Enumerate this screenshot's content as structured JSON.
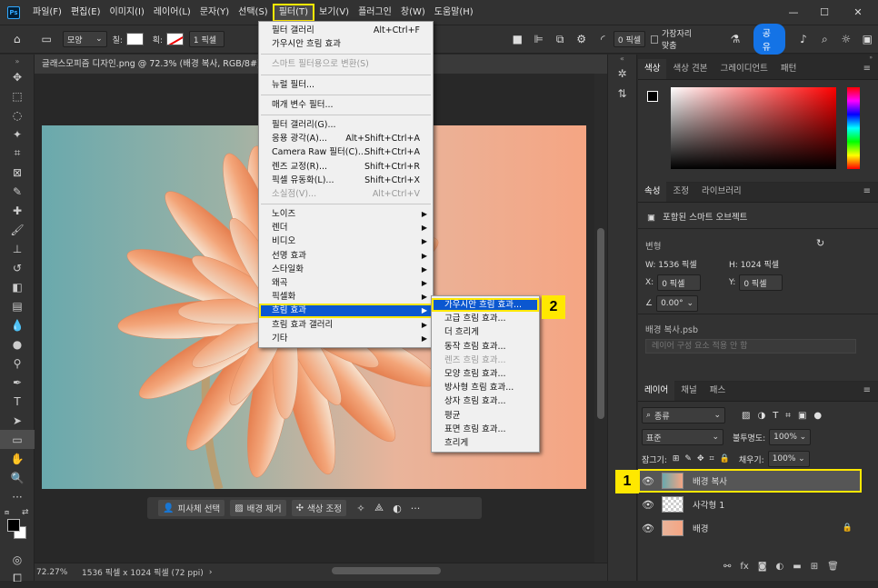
{
  "menubar": {
    "app_icon": "Ps",
    "items": [
      "파일(F)",
      "편집(E)",
      "이미지(I)",
      "레이어(L)",
      "문자(Y)",
      "선택(S)",
      "필터(T)",
      "보기(V)",
      "플러그인",
      "창(W)",
      "도움말(H)"
    ],
    "window_controls": [
      "—",
      "☐",
      "✕"
    ]
  },
  "options": {
    "shape_mode": "모양",
    "fill_label": "칠:",
    "stroke_label": "획:",
    "stroke_width": "1 픽셀",
    "radius": "0 픽셀",
    "align_edges": "가장자리 맞춤",
    "share": "공유"
  },
  "document": {
    "tab_title": "글래스모피즘 디자인.png @ 72.3% (배경 복사, RGB/8#)",
    "close": "×",
    "zoom": "72.27%",
    "info": "1536 픽셀 x 1024 픽셀 (72 ppi)",
    "scrollbar_thumb_offset": 0
  },
  "context_bar": {
    "select_subject": "피사체 선택",
    "remove_bg": "배경 제거",
    "color_adjust": "색상 조정"
  },
  "filter_menu": {
    "items": [
      {
        "label": "필터 갤러리",
        "shortcut": "Alt+Ctrl+F"
      },
      {
        "label": "가우시안 흐림 효과",
        "shortcut": ""
      },
      {
        "sep": true
      },
      {
        "label": "스마트 필터용으로 변환(S)",
        "shortcut": "",
        "disabled": true
      },
      {
        "sep": true
      },
      {
        "label": "뉴럴 필터...",
        "shortcut": ""
      },
      {
        "sep": true
      },
      {
        "label": "매개 변수 필터...",
        "shortcut": ""
      },
      {
        "sep": true
      },
      {
        "label": "필터 갤러리(G)...",
        "shortcut": ""
      },
      {
        "label": "응용 광각(A)...",
        "shortcut": "Alt+Shift+Ctrl+A"
      },
      {
        "label": "Camera Raw 필터(C)...",
        "shortcut": "Shift+Ctrl+A"
      },
      {
        "label": "렌즈 교정(R)...",
        "shortcut": "Shift+Ctrl+R"
      },
      {
        "label": "픽셀 유동화(L)...",
        "shortcut": "Shift+Ctrl+X"
      },
      {
        "label": "소실점(V)...",
        "shortcut": "Alt+Ctrl+V",
        "disabled": true
      },
      {
        "sep": true
      },
      {
        "label": "노이즈",
        "arrow": true
      },
      {
        "label": "렌더",
        "arrow": true
      },
      {
        "label": "비디오",
        "arrow": true
      },
      {
        "label": "선명 효과",
        "arrow": true
      },
      {
        "label": "스타일화",
        "arrow": true
      },
      {
        "label": "왜곡",
        "arrow": true
      },
      {
        "label": "픽셀화",
        "arrow": true
      },
      {
        "label": "흐림 효과",
        "arrow": true,
        "highlight": true
      },
      {
        "label": "흐림 효과 갤러리",
        "arrow": true
      },
      {
        "label": "기타",
        "arrow": true
      }
    ]
  },
  "blur_submenu": {
    "items": [
      {
        "label": "가우시안 흐림 효과...",
        "highlight": true
      },
      {
        "label": "고급 흐림 효과..."
      },
      {
        "label": "더 흐리게"
      },
      {
        "label": "동작 흐림 효과..."
      },
      {
        "label": "렌즈 흐림 효과...",
        "disabled": true
      },
      {
        "label": "모양 흐림 효과..."
      },
      {
        "label": "방사형 흐림 효과..."
      },
      {
        "label": "상자 흐림 효과..."
      },
      {
        "label": "평균"
      },
      {
        "label": "표면 흐림 효과..."
      },
      {
        "label": "흐리게"
      }
    ]
  },
  "badges": {
    "one": "1",
    "two": "2"
  },
  "color_panel": {
    "tabs": [
      "색상",
      "색상 견본",
      "그레이디언트",
      "패턴"
    ]
  },
  "properties_panel": {
    "tabs": [
      "속성",
      "조정",
      "라이브러리"
    ],
    "object_type": "포함된 스마트 오브젝트",
    "transform_label": "변형",
    "w_label": "W:",
    "w_value": "1536 픽셀",
    "h_label": "H:",
    "h_value": "1024 픽셀",
    "x_label": "X:",
    "x_value": "0 픽셀",
    "y_label": "Y:",
    "y_value": "0 픽셀",
    "angle": "0.00°",
    "source_file": "배경 복사.psb",
    "comp_placeholder": "레이어 구성 요소 적용 안 함"
  },
  "layers_panel": {
    "tabs": [
      "레이어",
      "채널",
      "패스"
    ],
    "filter_kind": "종류",
    "blend_mode": "표준",
    "opacity_label": "불투명도:",
    "opacity": "100%",
    "lock_label": "잠그기:",
    "fill_label": "채우기:",
    "fill": "100%",
    "layers": [
      {
        "name": "배경 복사",
        "selected": true
      },
      {
        "name": "사각형 1"
      },
      {
        "name": "배경",
        "locked": true
      }
    ]
  },
  "colors": {
    "accent": "#1473e6",
    "highlight": "#ffe800",
    "menu_sel": "#0b57d0"
  }
}
